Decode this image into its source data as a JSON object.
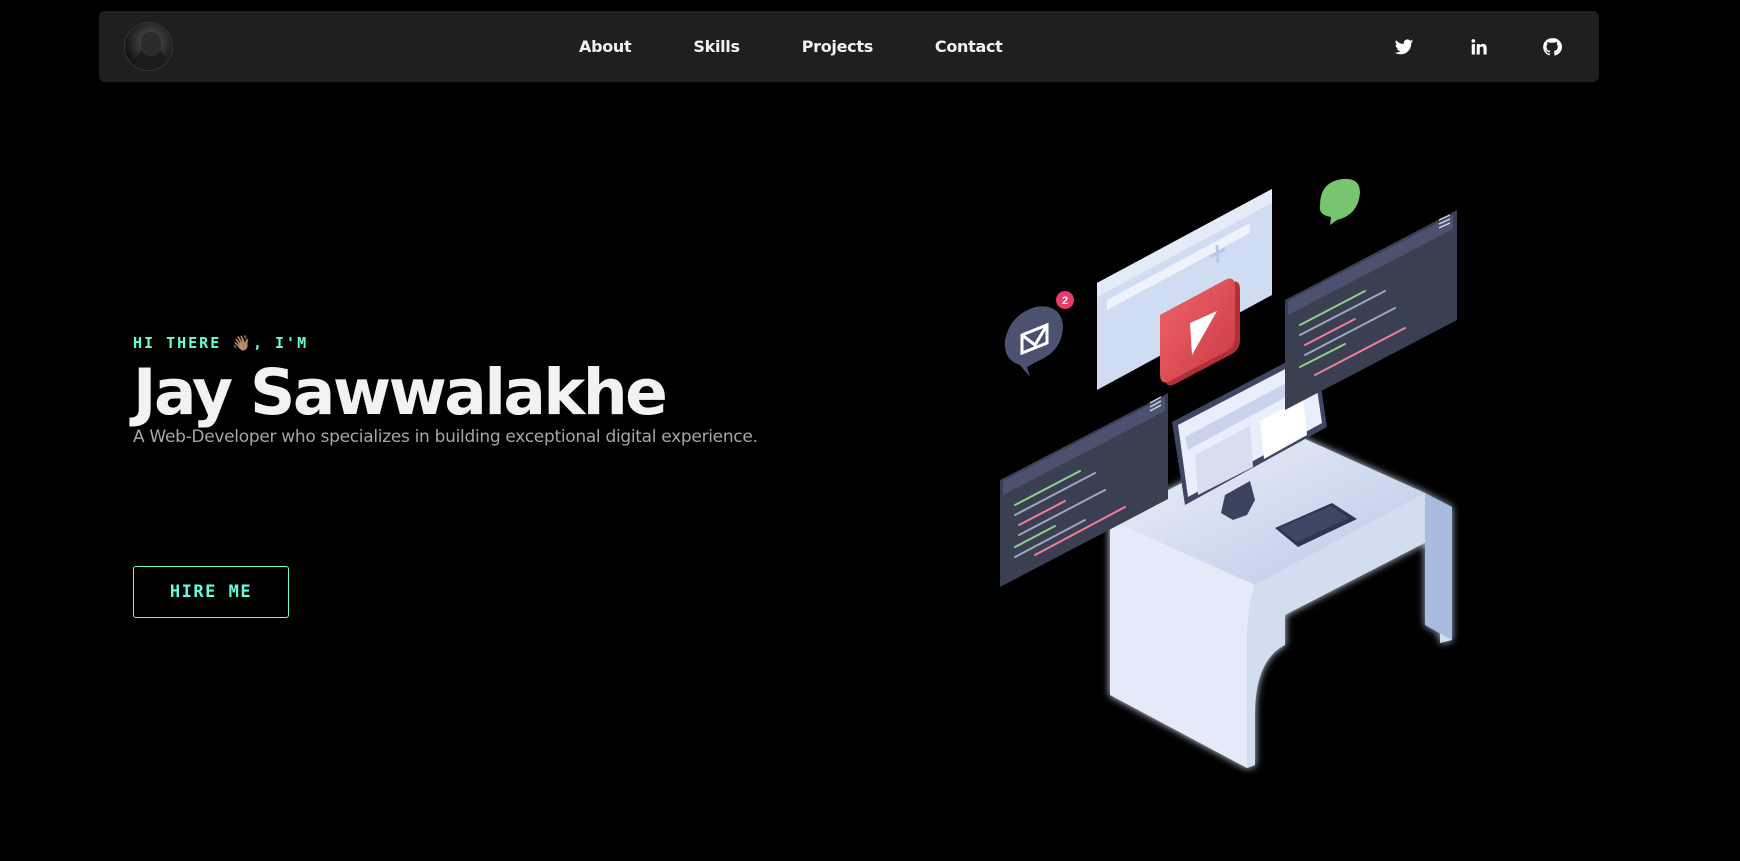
{
  "nav": {
    "avatar_alt": "Jay Sawwalakhe avatar",
    "links": [
      "About",
      "Skills",
      "Projects",
      "Contact"
    ],
    "socials": [
      "twitter-icon",
      "linkedin-icon",
      "github-icon"
    ]
  },
  "hero": {
    "greeting": "HI THERE 👋🏽, I'M",
    "name": "Jay Sawwalakhe",
    "subtitle": "A Web-Developer who specializes in building exceptional digital experience.",
    "cta_label": "HIRE ME"
  },
  "illustration": {
    "notification_count": "2"
  },
  "colors": {
    "accent": "#64ffda",
    "navbar_bg": "#1f1f1f",
    "background": "#000000",
    "play_button": "#e0464d"
  }
}
